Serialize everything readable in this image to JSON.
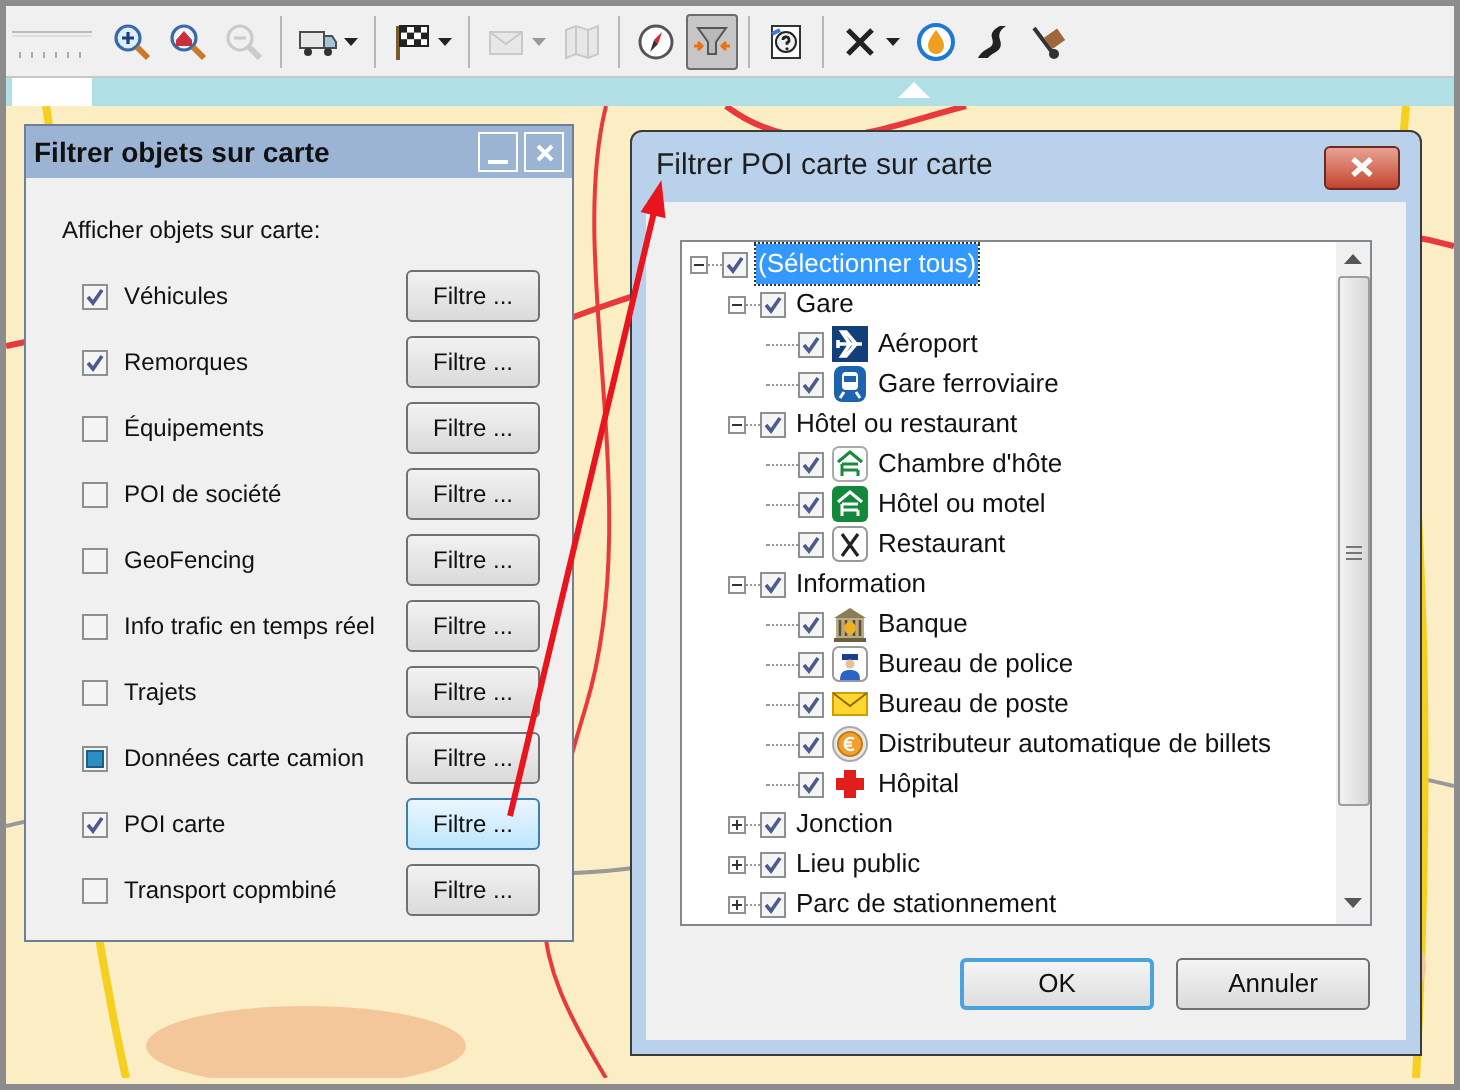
{
  "toolbar": {
    "groups": [
      [
        {
          "kind": "zoom-in",
          "disabled": false,
          "selected": false,
          "dropdown": false
        },
        {
          "kind": "zoom-home",
          "disabled": false,
          "selected": false,
          "dropdown": false
        },
        {
          "kind": "zoom-out",
          "disabled": true,
          "selected": false,
          "dropdown": false
        }
      ],
      [
        {
          "kind": "truck",
          "disabled": false,
          "selected": false,
          "dropdown": true
        }
      ],
      [
        {
          "kind": "flag",
          "disabled": false,
          "selected": false,
          "dropdown": true
        }
      ],
      [
        {
          "kind": "envelope",
          "disabled": true,
          "selected": false,
          "dropdown": true
        },
        {
          "kind": "map",
          "disabled": true,
          "selected": false,
          "dropdown": false
        }
      ],
      [
        {
          "kind": "compass",
          "disabled": false,
          "selected": false,
          "dropdown": false
        },
        {
          "kind": "filter",
          "disabled": false,
          "selected": true,
          "dropdown": false
        }
      ],
      [
        {
          "kind": "help",
          "disabled": false,
          "selected": false,
          "dropdown": false
        }
      ],
      [
        {
          "kind": "cross",
          "disabled": false,
          "selected": false,
          "dropdown": true
        },
        {
          "kind": "drop",
          "disabled": false,
          "selected": false,
          "dropdown": false
        },
        {
          "kind": "road",
          "disabled": false,
          "selected": false,
          "dropdown": false
        },
        {
          "kind": "dolly",
          "disabled": false,
          "selected": false,
          "dropdown": false
        }
      ]
    ]
  },
  "objects_dialog": {
    "title": "Filtrer objets sur carte",
    "heading": "Afficher objets sur carte:",
    "rows": [
      {
        "label": "Véhicules",
        "checked": true,
        "mixed": false,
        "button": "Filtre ...",
        "focused": false
      },
      {
        "label": "Remorques",
        "checked": true,
        "mixed": false,
        "button": "Filtre ...",
        "focused": false
      },
      {
        "label": "Équipements",
        "checked": false,
        "mixed": false,
        "button": "Filtre ...",
        "focused": false
      },
      {
        "label": "POI de société",
        "checked": false,
        "mixed": false,
        "button": "Filtre ...",
        "focused": false
      },
      {
        "label": "GeoFencing",
        "checked": false,
        "mixed": false,
        "button": "Filtre ...",
        "focused": false
      },
      {
        "label": "Info trafic en temps réel",
        "checked": false,
        "mixed": false,
        "button": "Filtre ...",
        "focused": false
      },
      {
        "label": "Trajets",
        "checked": false,
        "mixed": false,
        "button": "Filtre ...",
        "focused": false
      },
      {
        "label": "Données carte camion",
        "checked": false,
        "mixed": true,
        "button": "Filtre ...",
        "focused": false
      },
      {
        "label": "POI carte",
        "checked": true,
        "mixed": false,
        "button": "Filtre ...",
        "focused": true
      },
      {
        "label": "Transport copmbiné",
        "checked": false,
        "mixed": false,
        "button": "Filtre ...",
        "focused": false
      }
    ]
  },
  "poi_dialog": {
    "title": "Filtrer POI carte sur carte",
    "tree": [
      {
        "label": "(Sélectionner tous)",
        "checked": true,
        "selected": true,
        "expanded": true,
        "children": [
          {
            "label": "Gare",
            "checked": true,
            "selected": false,
            "expanded": true,
            "children": [
              {
                "label": "Aéroport",
                "kind": "airport",
                "checked": true,
                "selected": false
              },
              {
                "label": "Gare ferroviaire",
                "kind": "train",
                "checked": true,
                "selected": false
              }
            ]
          },
          {
            "label": "Hôtel ou restaurant",
            "checked": true,
            "selected": false,
            "expanded": true,
            "children": [
              {
                "label": "Chambre d'hôte",
                "kind": "guesthouse",
                "checked": true,
                "selected": false
              },
              {
                "label": "Hôtel ou motel",
                "kind": "hotel",
                "checked": true,
                "selected": false
              },
              {
                "label": "Restaurant",
                "kind": "restaurant",
                "checked": true,
                "selected": false
              }
            ]
          },
          {
            "label": "Information",
            "checked": true,
            "selected": false,
            "expanded": true,
            "children": [
              {
                "label": "Banque",
                "kind": "bank",
                "checked": true,
                "selected": false
              },
              {
                "label": "Bureau de police",
                "kind": "police",
                "checked": true,
                "selected": false
              },
              {
                "label": "Bureau de poste",
                "kind": "post",
                "checked": true,
                "selected": false
              },
              {
                "label": "Distributeur automatique de billets",
                "kind": "atm",
                "checked": true,
                "selected": false
              },
              {
                "label": "Hôpital",
                "kind": "hospital",
                "checked": true,
                "selected": false
              }
            ]
          },
          {
            "label": "Jonction",
            "checked": true,
            "selected": false,
            "expanded": false
          },
          {
            "label": "Lieu public",
            "checked": true,
            "selected": false,
            "expanded": false
          },
          {
            "label": "Parc de stationnement",
            "checked": true,
            "selected": false,
            "expanded": false
          }
        ]
      }
    ],
    "buttons": [
      {
        "label": "OK",
        "focused": true
      },
      {
        "label": "Annuler",
        "focused": false
      }
    ]
  }
}
